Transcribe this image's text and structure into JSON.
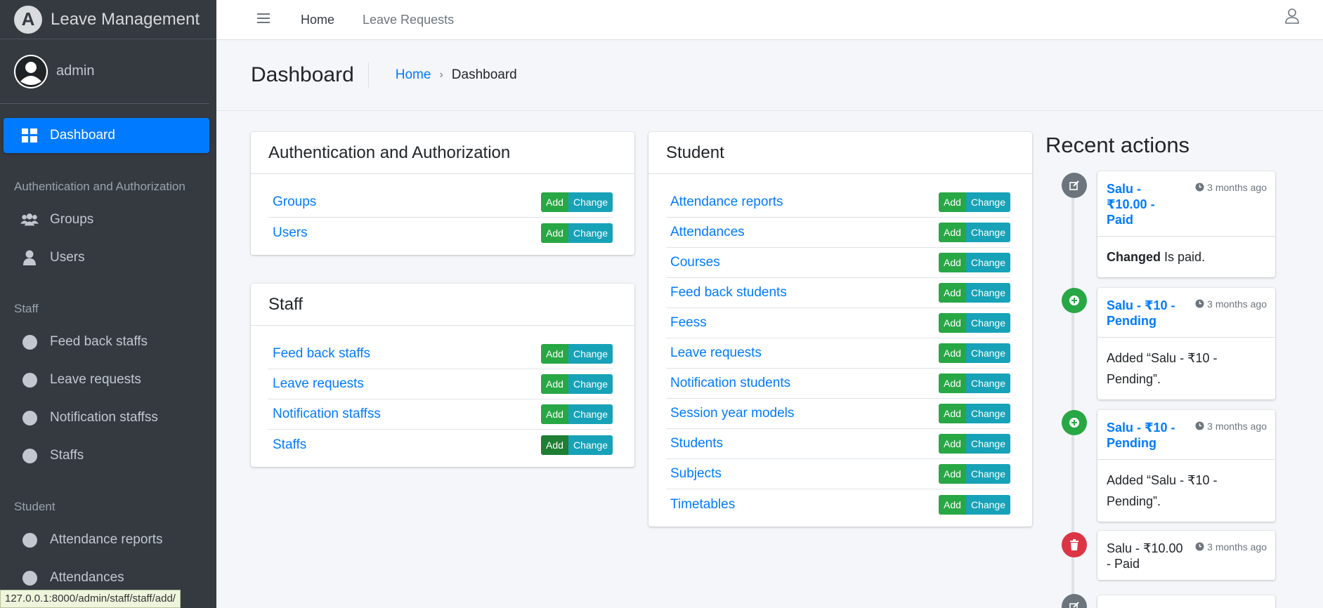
{
  "brand": {
    "logo_letter": "A",
    "title": "Leave Management"
  },
  "user": {
    "name": "admin"
  },
  "sidebar": {
    "dashboard": "Dashboard",
    "sections": [
      {
        "header": "Authentication and Authorization",
        "items": [
          "Groups",
          "Users"
        ]
      },
      {
        "header": "Staff",
        "items": [
          "Feed back staffs",
          "Leave requests",
          "Notification staffss",
          "Staffs"
        ]
      },
      {
        "header": "Student",
        "items": [
          "Attendance reports",
          "Attendances"
        ]
      }
    ]
  },
  "topnav": {
    "home": "Home",
    "leave_requests": "Leave Requests"
  },
  "header": {
    "title": "Dashboard",
    "breadcrumb_home": "Home",
    "breadcrumb_sep": "›",
    "breadcrumb_current": "Dashboard"
  },
  "buttons": {
    "add": "Add",
    "change": "Change"
  },
  "apps": {
    "auth": {
      "title": "Authentication and Authorization",
      "models": [
        "Groups",
        "Users"
      ]
    },
    "staff": {
      "title": "Staff",
      "models": [
        "Feed back staffs",
        "Leave requests",
        "Notification staffss",
        "Staffs"
      ]
    },
    "student": {
      "title": "Student",
      "models": [
        "Attendance reports",
        "Attendances",
        "Courses",
        "Feed back students",
        "Feess",
        "Leave requests",
        "Notification students",
        "Session year models",
        "Students",
        "Subjects",
        "Timetables"
      ]
    }
  },
  "recent": {
    "title": "Recent actions",
    "actions": [
      {
        "type": "change",
        "object": "Salu - ₹10.00 - Paid",
        "time": "3 months ago",
        "verb": "Changed",
        "detail": "Is paid."
      },
      {
        "type": "add",
        "object": "Salu - ₹10 - Pending",
        "time": "3 months ago",
        "detail": "Added “Salu - ₹10 - Pending”."
      },
      {
        "type": "add",
        "object": "Salu - ₹10 - Pending",
        "time": "3 months ago",
        "detail": "Added “Salu - ₹10 - Pending”."
      },
      {
        "type": "delete",
        "object": "Salu - ₹10.00 - Paid",
        "time": "3 months ago"
      }
    ]
  },
  "status_url": "127.0.0.1:8000/admin/staff/staff/add/",
  "colors": {
    "sidebar": "#343a40",
    "primary": "#007bff",
    "success": "#28a745",
    "info": "#17a2b8",
    "danger": "#dc3545",
    "secondary": "#6c757d"
  }
}
